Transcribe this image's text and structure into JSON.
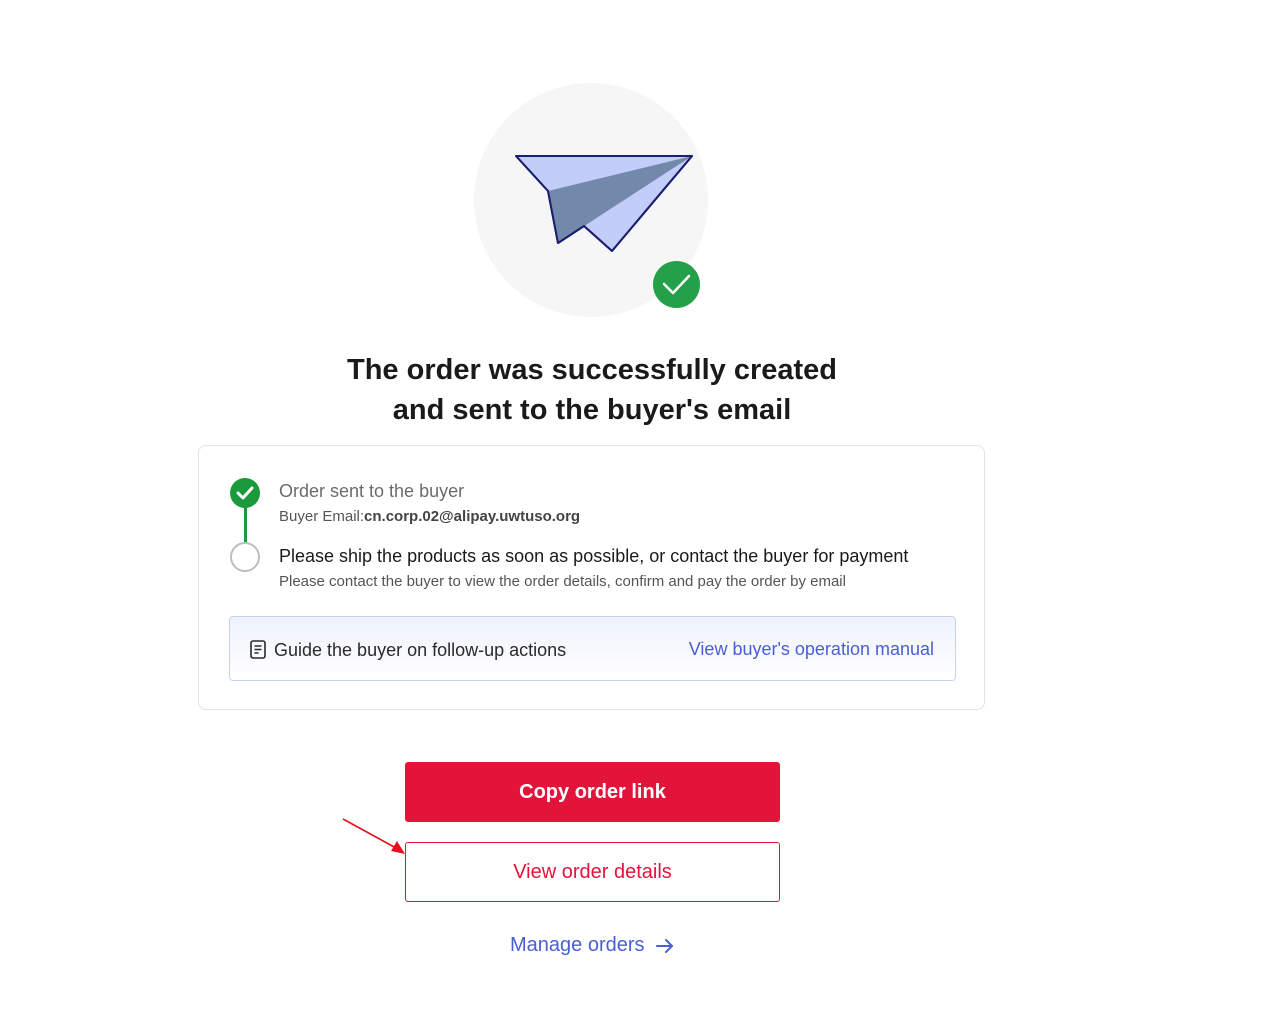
{
  "title": {
    "line1": "The order was successfully created",
    "line2": "and sent to the buyer's email"
  },
  "steps": [
    {
      "title": "Order sent to the buyer",
      "detail_label": "Buyer Email:",
      "detail_value": "cn.corp.02@alipay.uwtuso.org",
      "status": "done"
    },
    {
      "title": "Please ship the products as soon as possible, or contact the buyer for payment",
      "detail": "Please contact the buyer to view the order details, confirm and pay the order by email",
      "status": "pending"
    }
  ],
  "guide": {
    "icon": "document-icon",
    "text": "Guide the buyer on follow-up actions",
    "link": "View buyer's operation manual"
  },
  "buttons": {
    "copy_link": "Copy order link",
    "view_details": "View order details",
    "manage_orders": "Manage orders"
  },
  "icons": {
    "hero": "paper-plane-icon",
    "success": "check-icon",
    "manage_arrow": "arrow-right-icon",
    "annotation": "red-arrow-annotation"
  },
  "colors": {
    "primary": "#e4133a",
    "success": "#1a9a3a",
    "link": "#4a5fd3"
  }
}
